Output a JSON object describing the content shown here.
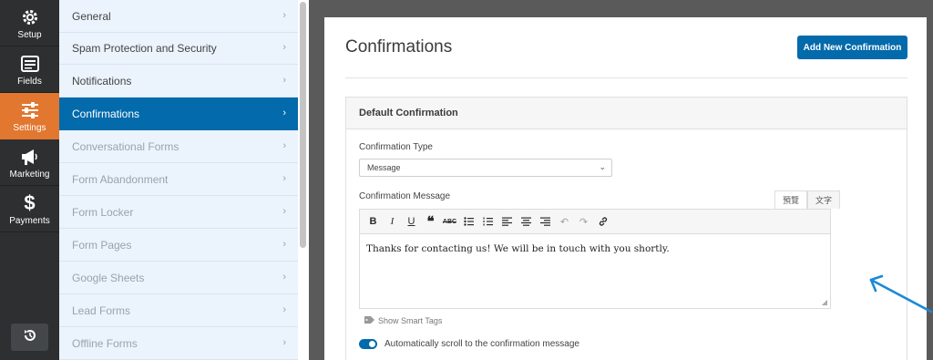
{
  "rail": {
    "items": [
      {
        "label": "Setup",
        "icon": "gear-icon"
      },
      {
        "label": "Fields",
        "icon": "list-icon"
      },
      {
        "label": "Settings",
        "icon": "sliders-icon"
      },
      {
        "label": "Marketing",
        "icon": "megaphone-icon"
      },
      {
        "label": "Payments",
        "icon": "dollar-icon"
      }
    ],
    "active": "Settings",
    "accent": "#e27730"
  },
  "nav": {
    "items": [
      {
        "label": "General"
      },
      {
        "label": "Spam Protection and Security"
      },
      {
        "label": "Notifications"
      },
      {
        "label": "Confirmations"
      },
      {
        "label": "Conversational Forms"
      },
      {
        "label": "Form Abandonment"
      },
      {
        "label": "Form Locker"
      },
      {
        "label": "Form Pages"
      },
      {
        "label": "Google Sheets"
      },
      {
        "label": "Lead Forms"
      },
      {
        "label": "Offline Forms"
      }
    ],
    "active": "Confirmations",
    "accent": "#036aab"
  },
  "main": {
    "title": "Confirmations",
    "add_button": "Add New Confirmation",
    "section_title": "Default Confirmation",
    "type_label": "Confirmation Type",
    "type_value": "Message",
    "message_label": "Confirmation Message",
    "tabs": [
      "預覽",
      "文字"
    ],
    "message_text": "Thanks for contacting us! We will be in touch with you shortly.",
    "smart_tags": "Show Smart Tags",
    "scroll_label": "Automatically scroll to the confirmation message",
    "scroll_enabled": true
  }
}
